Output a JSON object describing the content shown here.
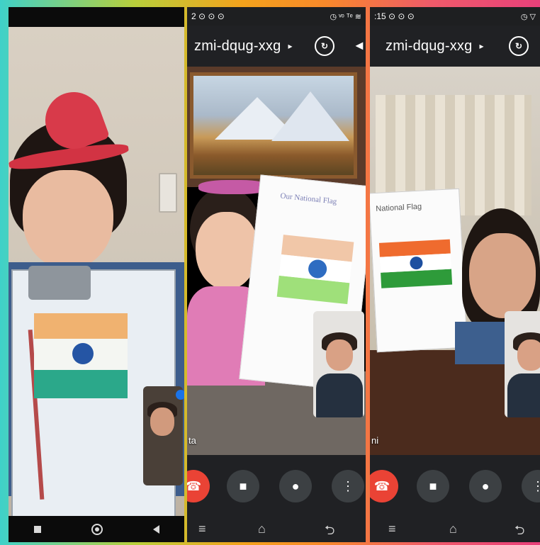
{
  "colors": {
    "accent_end_call": "#ea4335",
    "control_bg": "#3c4043",
    "meet_bg": "#202124"
  },
  "panel_2": {
    "status_time": "2",
    "status_icons": "⊙ ⊙ ⊙",
    "status_right": "◷ ᵛᵒ ᵀᵉ ≋",
    "meeting_code": "zmi-dqug-xxg",
    "caret": "▸",
    "flip_camera_icon": "↻",
    "speaker_icon": "◄",
    "participant_name": "ta",
    "paper_title": "Our National Flag",
    "controls": {
      "end_call_icon": "☎",
      "camera_icon": "■",
      "mic_icon": "●",
      "more_icon": "⋮"
    },
    "nav": {
      "menu": "≡",
      "home": "⌂",
      "back": "⮌"
    }
  },
  "panel_3": {
    "status_time": ":15",
    "status_icons": "⊙ ⊙ ⊙",
    "status_right": "◷ ▽",
    "meeting_code": "zmi-dqug-xxg",
    "caret": "▸",
    "flip_camera_icon": "↻",
    "participant_name": "ni",
    "paper_title": "National Flag",
    "controls": {
      "end_call_icon": "☎",
      "camera_icon": "■",
      "mic_icon": "●",
      "more_icon": "⋮"
    },
    "nav": {
      "menu": "≡",
      "home": "⌂",
      "back": "⮌"
    }
  }
}
